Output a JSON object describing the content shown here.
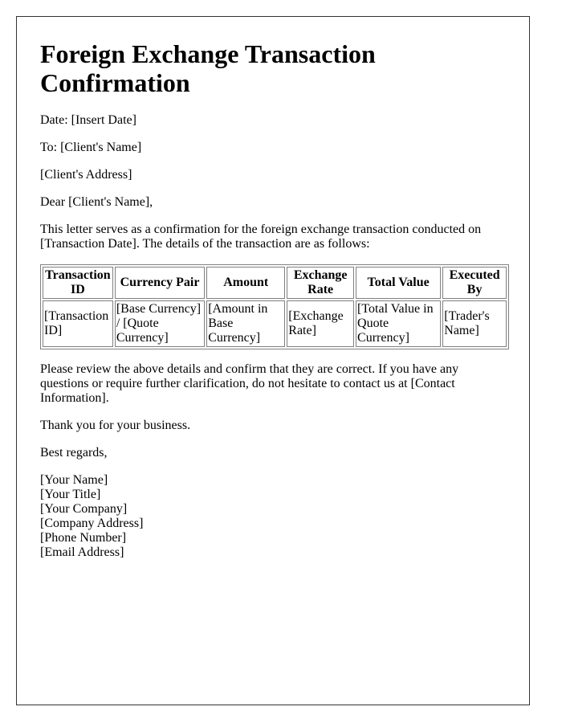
{
  "title": "Foreign Exchange Transaction Confirmation",
  "date_line": "Date: [Insert Date]",
  "to_line": "To: [Client's Name]",
  "address_line": "[Client's Address]",
  "salutation": "Dear [Client's Name],",
  "intro": "This letter serves as a confirmation for the foreign exchange transaction conducted on [Transaction Date]. The details of the transaction are as follows:",
  "table": {
    "headers": [
      "Transaction ID",
      "Currency Pair",
      "Amount",
      "Exchange Rate",
      "Total Value",
      "Executed By"
    ],
    "rows": [
      [
        "[Transaction ID]",
        "[Base Currency] / [Quote Currency]",
        "[Amount in Base Currency]",
        "[Exchange Rate]",
        "[Total Value in Quote Currency]",
        "[Trader's Name]"
      ]
    ]
  },
  "review_paragraph": "Please review the above details and confirm that they are correct. If you have any questions or require further clarification, do not hesitate to contact us at [Contact Information].",
  "thanks": "Thank you for your business.",
  "closing": "Best regards,",
  "signature": [
    "[Your Name]",
    "[Your Title]",
    "[Your Company]",
    "[Company Address]",
    "[Phone Number]",
    "[Email Address]"
  ]
}
